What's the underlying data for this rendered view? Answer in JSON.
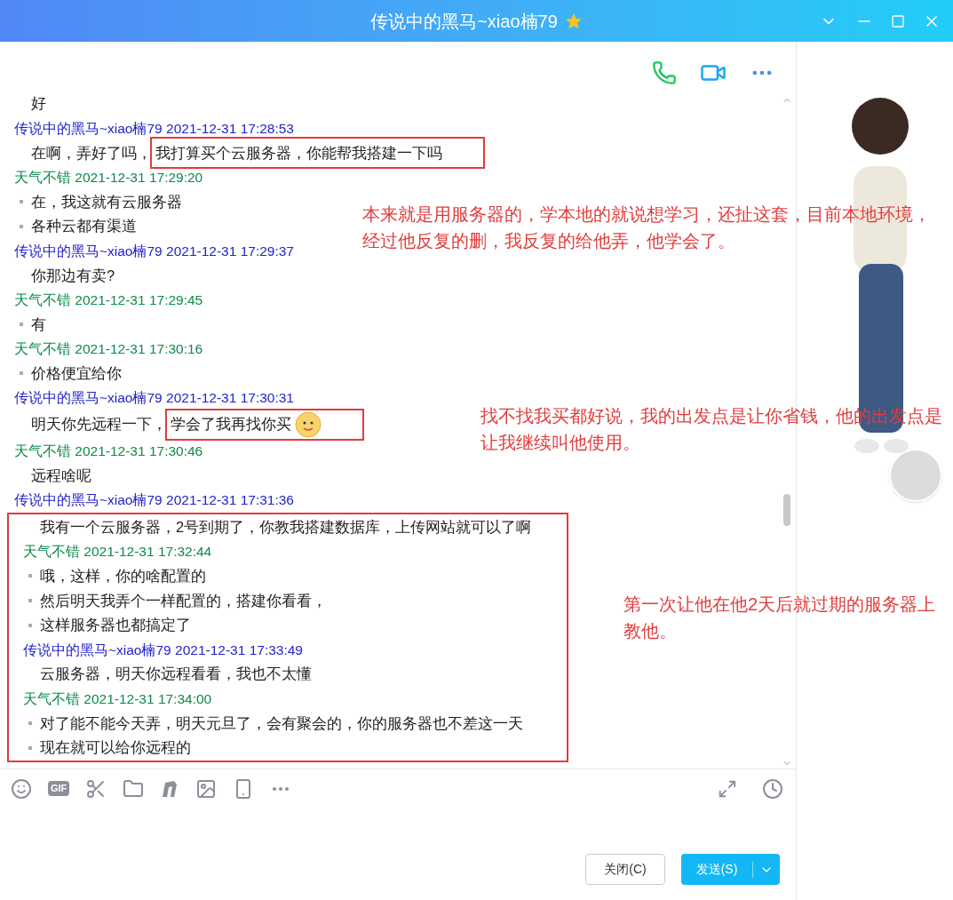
{
  "window": {
    "title": "传说中的黑马~xiao楠79"
  },
  "chat": {
    "entries": [
      {
        "kind": "line",
        "bullet": false,
        "text": "好"
      },
      {
        "kind": "header",
        "color": "#2222cc",
        "sender": "传说中的黑马~xiao楠79",
        "time": "2021-12-31 17:28:53"
      },
      {
        "kind": "line",
        "bullet": false,
        "text": "在啊，弄好了吗，",
        "boxed_text": "我打算买个云服务器，你能帮我搭建一下吗"
      },
      {
        "kind": "header",
        "color": "#0b8a4a",
        "sender": "天气不错",
        "time": "2021-12-31 17:29:20"
      },
      {
        "kind": "line",
        "bullet": true,
        "text": "在，我这就有云服务器"
      },
      {
        "kind": "line",
        "bullet": true,
        "text": "各种云都有渠道"
      },
      {
        "kind": "header",
        "color": "#2222cc",
        "sender": "传说中的黑马~xiao楠79",
        "time": "2021-12-31 17:29:37"
      },
      {
        "kind": "line",
        "bullet": false,
        "text": "你那边有卖?"
      },
      {
        "kind": "header",
        "color": "#0b8a4a",
        "sender": "天气不错",
        "time": "2021-12-31 17:29:45"
      },
      {
        "kind": "line",
        "bullet": true,
        "text": "有"
      },
      {
        "kind": "header",
        "color": "#0b8a4a",
        "sender": "天气不错",
        "time": "2021-12-31 17:30:16"
      },
      {
        "kind": "line",
        "bullet": true,
        "text": "价格便宜给你"
      },
      {
        "kind": "header",
        "color": "#2222cc",
        "sender": "传说中的黑马~xiao楠79",
        "time": "2021-12-31 17:30:31"
      },
      {
        "kind": "line",
        "bullet": false,
        "text": "明天你先远程一下，",
        "boxed_text": "学会了我再找你买",
        "emoji": true
      },
      {
        "kind": "header",
        "color": "#0b8a4a",
        "sender": "天气不错",
        "time": "2021-12-31 17:30:46"
      },
      {
        "kind": "line",
        "bullet": false,
        "text": "远程啥呢"
      },
      {
        "kind": "header",
        "color": "#2222cc",
        "sender": "传说中的黑马~xiao楠79",
        "time": "2021-12-31 17:31:36"
      },
      {
        "kind": "group",
        "entries": [
          {
            "kind": "line",
            "bullet": false,
            "text": "我有一个云服务器，2号到期了，你教我搭建数据库，上传网站就可以了啊"
          },
          {
            "kind": "header",
            "color": "#0b8a4a",
            "sender": "天气不错",
            "time": "2021-12-31 17:32:44"
          },
          {
            "kind": "line",
            "bullet": true,
            "text": "哦，这样，你的啥配置的"
          },
          {
            "kind": "line",
            "bullet": true,
            "text": "然后明天我弄个一样配置的，搭建你看看，"
          },
          {
            "kind": "line",
            "bullet": true,
            "text": "这样服务器也都搞定了"
          },
          {
            "kind": "header",
            "color": "#2222cc",
            "sender": "传说中的黑马~xiao楠79",
            "time": "2021-12-31 17:33:49"
          },
          {
            "kind": "line",
            "bullet": false,
            "text": "云服务器，明天你远程看看，我也不太懂"
          },
          {
            "kind": "header",
            "color": "#0b8a4a",
            "sender": "天气不错",
            "time": "2021-12-31 17:34:00"
          },
          {
            "kind": "line",
            "bullet": true,
            "text": "对了能不能今天弄，明天元旦了，会有聚会的，你的服务器也不差这一天"
          },
          {
            "kind": "line",
            "bullet": true,
            "text": "现在就可以给你远程的"
          }
        ]
      }
    ]
  },
  "notes": [
    "本来就是用服务器的，学本地的就说想学习，还扯这套，目前本地环境，经过他反复的删，我反复的给他弄，他学会了。",
    "找不找我买都好说，我的出发点是让你省钱，他的出发点是让我继续叫他使用。",
    "第一次让他在他2天后就过期的服务器上教他。"
  ],
  "composer": {
    "gif_label": "GIF"
  },
  "buttons": {
    "close": "关闭(C)",
    "send": "发送(S)"
  }
}
